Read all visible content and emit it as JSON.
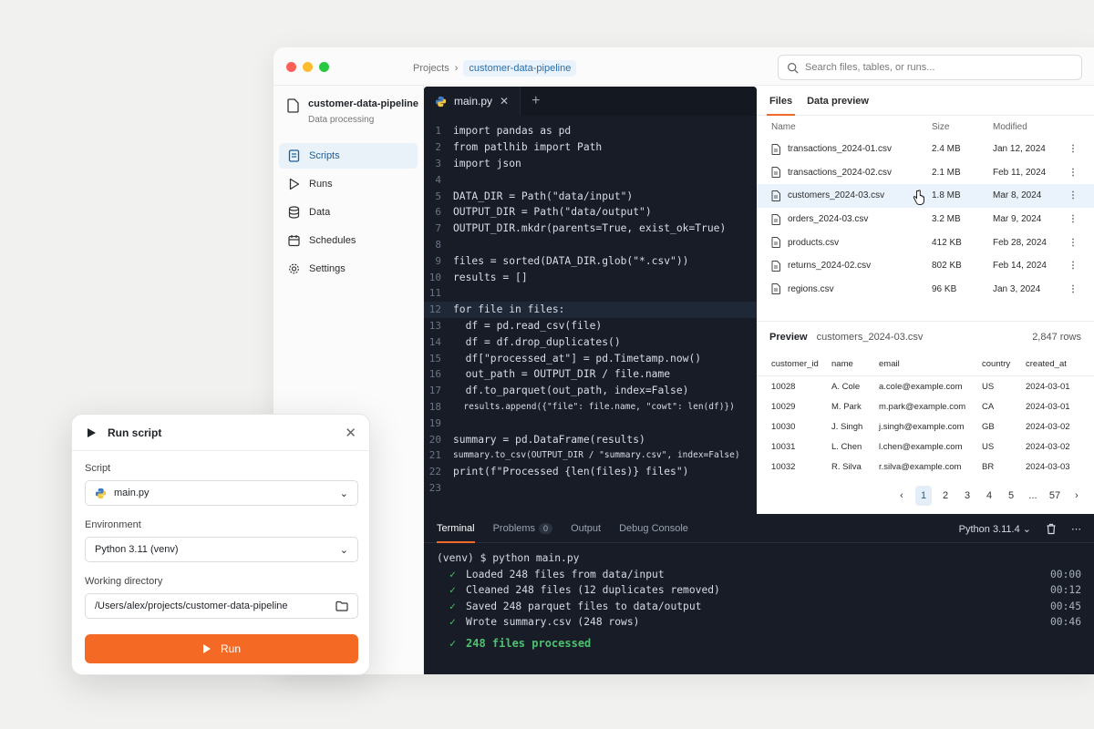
{
  "window": {
    "dot_colors": [
      "#fe5f57",
      "#febc2e",
      "#28c840"
    ],
    "breadcrumb": {
      "root": "Projects",
      "sep": "›",
      "current": "customer-data-pipeline"
    },
    "search": {
      "placeholder": "Search files, tables, or runs..."
    }
  },
  "sidebar": {
    "project_name": "customer-data-pipeline",
    "project_subtitle": "Data processing",
    "items": [
      {
        "label": "Scripts",
        "icon": "file-code-icon",
        "active": true
      },
      {
        "label": "Runs",
        "icon": "play-icon",
        "active": false
      },
      {
        "label": "Data",
        "icon": "database-icon",
        "active": false
      },
      {
        "label": "Schedules",
        "icon": "calendar-icon",
        "active": false
      },
      {
        "label": "Settings",
        "icon": "gear-icon",
        "active": false
      }
    ]
  },
  "editor": {
    "tab_label": "main.py",
    "lines": [
      {
        "n": "1",
        "t": "import pandas as pd"
      },
      {
        "n": "2",
        "t": "from patlhib import Path"
      },
      {
        "n": "3",
        "t": "import json"
      },
      {
        "n": "4",
        "t": ""
      },
      {
        "n": "5",
        "t": "DATA_DIR = Path(\"data/input\")"
      },
      {
        "n": "6",
        "t": "OUTPUT_DIR = Path(\"data/output\")"
      },
      {
        "n": "7",
        "t": "OUTPUT_DIR.mkdr(parents=True, exist_ok=True)"
      },
      {
        "n": "8",
        "t": ""
      },
      {
        "n": "9",
        "t": "files = sorted(DATA_DIR.glob(\"*.csv\"))"
      },
      {
        "n": "10",
        "t": "results = []"
      },
      {
        "n": "11",
        "t": ""
      },
      {
        "n": "12",
        "t": "for file in files:"
      },
      {
        "n": "13",
        "t": "  df = pd.read_csv(file)"
      },
      {
        "n": "14",
        "t": "  df = df.drop_duplicates()"
      },
      {
        "n": "15",
        "t": "  df[\"processed_at\"] = pd.Timetamp.now()"
      },
      {
        "n": "16",
        "t": "  out_path = OUTPUT_DIR / file.name"
      },
      {
        "n": "17",
        "t": "  df.to_parquet(out_path, index=False)"
      },
      {
        "n": "18",
        "t": "  results.append({\"file\": file.name, \"cowt\": len(df)})"
      },
      {
        "n": "19",
        "t": ""
      },
      {
        "n": "20",
        "t": "summary = pd.DataFrame(results)"
      },
      {
        "n": "21",
        "t": "summary.to_csv(OUTPUT_DIR / \"summary.csv\", index=False)"
      },
      {
        "n": "22",
        "t": "print(f\"Processed {len(files)} files\")"
      },
      {
        "n": "23",
        "t": ""
      }
    ]
  },
  "files_panel": {
    "tabs": [
      "Files",
      "Data preview"
    ],
    "columns": [
      "Name",
      "Size",
      "Modified"
    ],
    "rows": [
      {
        "name": "transactions_2024-01.csv",
        "size": "2.4 MB",
        "modified": "Jan 12, 2024"
      },
      {
        "name": "transactions_2024-02.csv",
        "size": "2.1 MB",
        "modified": "Feb 11, 2024"
      },
      {
        "name": "customers_2024-03.csv",
        "size": "1.8 MB",
        "modified": "Mar 8, 2024"
      },
      {
        "name": "orders_2024-03.csv",
        "size": "3.2 MB",
        "modified": "Mar 9, 2024"
      },
      {
        "name": "products.csv",
        "size": "412 KB",
        "modified": "Feb 28, 2024"
      },
      {
        "name": "returns_2024-02.csv",
        "size": "802 KB",
        "modified": "Feb 14, 2024"
      },
      {
        "name": "regions.csv",
        "size": "96 KB",
        "modified": "Jan 3, 2024"
      }
    ]
  },
  "preview": {
    "title": "Preview",
    "file": "customers_2024-03.csv",
    "rows_count": "2,847 rows",
    "columns": [
      "customer_id",
      "name",
      "email",
      "country",
      "created_at"
    ],
    "rows": [
      [
        "10028",
        "A. Cole",
        "a.cole@example.com",
        "US",
        "2024-03-01"
      ],
      [
        "10029",
        "M. Park",
        "m.park@example.com",
        "CA",
        "2024-03-01"
      ],
      [
        "10030",
        "J. Singh",
        "j.singh@example.com",
        "GB",
        "2024-03-02"
      ],
      [
        "10031",
        "L. Chen",
        "l.chen@example.com",
        "US",
        "2024-03-02"
      ],
      [
        "10032",
        "R. Silva",
        "r.silva@example.com",
        "BR",
        "2024-03-03"
      ]
    ],
    "pages": [
      "1",
      "2",
      "3",
      "4",
      "5",
      "...",
      "57"
    ],
    "current_page": "1"
  },
  "terminal": {
    "tabs": {
      "terminal": "Terminal",
      "problems": "Problems",
      "problems_count": "0",
      "output": "Output",
      "debug": "Debug Console"
    },
    "python_version": "Python 3.11.4",
    "prompt": "(venv)  $ python main.py",
    "lines": [
      {
        "text": "Loaded 248 files from data/input",
        "time": "00:00"
      },
      {
        "text": "Cleaned 248 files (12 duplicates removed)",
        "time": "00:12"
      },
      {
        "text": "Saved 248 parquet files to data/output",
        "time": "00:45"
      },
      {
        "text": "Wrote summary.csv (248 rows)",
        "time": "00:46"
      }
    ],
    "done": "248 files processed"
  },
  "dialog": {
    "title": "Run script",
    "script_label": "Script",
    "script_value": "main.py",
    "env_label": "Environment",
    "env_value": "Python 3.11 (venv)",
    "dir_label": "Working directory",
    "dir_value": "/Users/alex/projects/customer-data-pipeline",
    "run_label": "Run"
  }
}
